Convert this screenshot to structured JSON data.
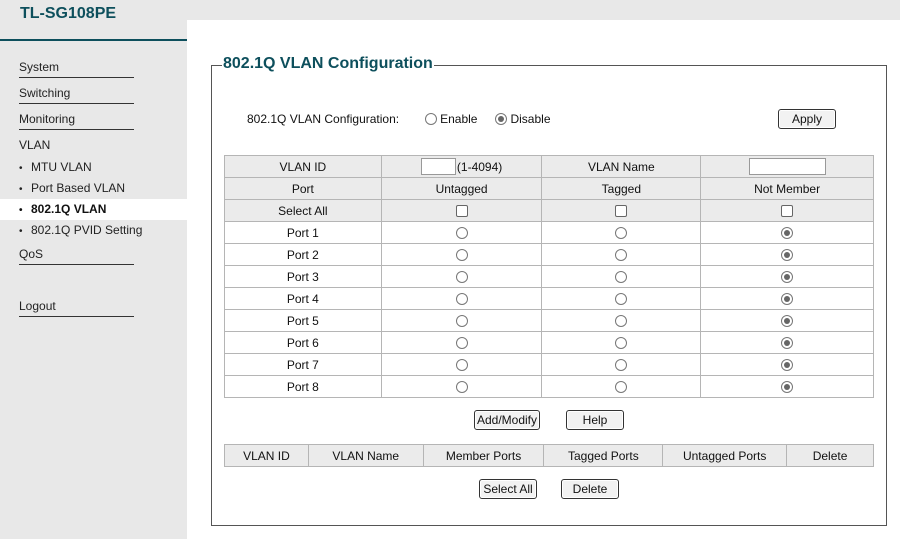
{
  "brand": "TL-SG108PE",
  "sidebar": {
    "items": [
      {
        "label": "System"
      },
      {
        "label": "Switching"
      },
      {
        "label": "Monitoring"
      },
      {
        "label": "VLAN"
      }
    ],
    "vlan_sub": [
      {
        "label": "MTU VLAN"
      },
      {
        "label": "Port Based VLAN"
      },
      {
        "label": "802.1Q VLAN"
      },
      {
        "label": "802.1Q PVID Setting"
      }
    ],
    "qos": "QoS",
    "logout": "Logout"
  },
  "main": {
    "legend": "802.1Q VLAN Configuration",
    "config_label": "802.1Q VLAN Configuration:",
    "enable_label": "Enable",
    "disable_label": "Disable",
    "selected_mode": "Disable",
    "apply_label": "Apply",
    "vlan_id_label": "VLAN ID",
    "vlan_id_value": "",
    "vlan_id_range": "(1-4094)",
    "vlan_name_label": "VLAN Name",
    "vlan_name_value": "",
    "port_header": "Port",
    "untagged_header": "Untagged",
    "tagged_header": "Tagged",
    "not_member_header": "Not Member",
    "select_all_label": "Select All",
    "ports": [
      {
        "name": "Port 1",
        "membership": "Not Member"
      },
      {
        "name": "Port 2",
        "membership": "Not Member"
      },
      {
        "name": "Port 3",
        "membership": "Not Member"
      },
      {
        "name": "Port 4",
        "membership": "Not Member"
      },
      {
        "name": "Port 5",
        "membership": "Not Member"
      },
      {
        "name": "Port 6",
        "membership": "Not Member"
      },
      {
        "name": "Port 7",
        "membership": "Not Member"
      },
      {
        "name": "Port 8",
        "membership": "Not Member"
      }
    ],
    "add_modify_label": "Add/Modify",
    "help_label": "Help",
    "summary_headers": [
      "VLAN ID",
      "VLAN Name",
      "Member Ports",
      "Tagged Ports",
      "Untagged Ports",
      "Delete"
    ],
    "select_all_button": "Select All",
    "delete_button": "Delete"
  },
  "colors": {
    "brand": "#0d4f5c",
    "sidebar_bg": "#e8e8e8",
    "table_header_bg": "#ebebeb"
  }
}
